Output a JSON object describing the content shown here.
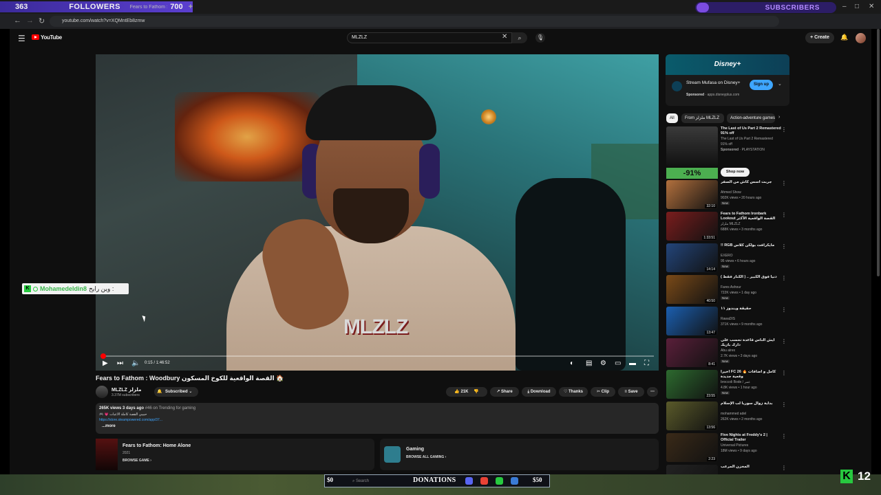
{
  "overlay": {
    "followers_count": "363",
    "followers_label": "FOLLOWERS",
    "followers_target": "700",
    "tab_text": "Fears to Fathom : Woodbury",
    "subscribers_label": "SUBSCRIBERS",
    "plus": "+"
  },
  "browser": {
    "url": "youtube.com/watch?v=XQMntEb8zmw"
  },
  "header": {
    "logo_text": "YouTube",
    "search_value": "MLZLZ",
    "create_label": "+ Create"
  },
  "player": {
    "time_current": "0:15",
    "time_total": "1:46:52",
    "progress": 0.002,
    "video_logo": "MLZLZ"
  },
  "chat": {
    "username": "Mohamedeldin8",
    "message": "وين رايح :"
  },
  "video": {
    "title": "Fears to Fathom : Woodbury القصة الواقعية للكوخ المسكون 🏠",
    "channel_name": "MLZLZ ملزلز",
    "channel_subs": "3.37M subscribers",
    "subscribed_label": "Subscribed",
    "likes": "21K",
    "share": "Share",
    "download": "Download",
    "thanks": "Thanks",
    "clip": "Clip",
    "save": "Save",
    "more_icon": "⋯"
  },
  "description": {
    "views": "265K views",
    "age": "3 days ago",
    "trending": "#46 on Trending for gaming",
    "line1": "🎮 💗 حبيبي القصة كاملة الاعبات",
    "link": "https://store.steampowered.com/app/37...",
    "more": "...more"
  },
  "game_card": {
    "title": "Fears to Fathom: Home Alone",
    "year": "2021",
    "browse": "BROWSE GAME"
  },
  "gaming_card": {
    "title": "Gaming",
    "browse": "BROWSE ALL GAMING"
  },
  "ad": {
    "brand": "Disney+",
    "title": "Stream Mufasa on Disney+",
    "sponsored": "Sponsored",
    "domain": "apps.disneyplus.com",
    "signup": "Sign up"
  },
  "chips": [
    "All",
    "From ملزلز MLZLZ",
    "Action-adventure games"
  ],
  "promo": {
    "title": "The Last of Us Part 2 Remastered 91% off",
    "line": "The Last of Us Part 2 Remastered",
    "line2": "91% off",
    "sponsored": "Sponsored",
    "advertiser": "PLAYSTATION",
    "discount": "-91%",
    "shop": "Shop now"
  },
  "recommendations": [
    {
      "title": "جربت أسس كاش من الصفر",
      "channel": "Ahmed Show",
      "meta": "902K views • 20 hours ago",
      "badge": "New",
      "duration": "32:10",
      "color": "#b2703d"
    },
    {
      "title": "Fears to Fathom Ironbark Lookout القصة الواقعية الأكثر رعبا",
      "channel": "ملزلز MLZLZ",
      "meta": "688K views • 3 months ago",
      "badge": "",
      "duration": "1:33:51",
      "color": "#7a1d1d"
    },
    {
      "title": "!! RGB مايكرافت بولكن كلاس",
      "channel": "EXERO",
      "meta": "95 views • 6 hours ago",
      "badge": "New",
      "duration": "14:14",
      "color": "#23457a"
    },
    {
      "title": "دنيا فوق الكبير .. ( الكنار فقط )",
      "channel": "Fares Ashour",
      "meta": "722K views • 1 day ago",
      "badge": "New",
      "duration": "40:50",
      "color": "#7a4a18"
    },
    {
      "title": "حقيقة ويندوز ١١",
      "channel": "RawaDIS",
      "meta": "371K views • 9 months ago",
      "badge": "",
      "duration": "13:47",
      "color": "#1b5fb0"
    },
    {
      "title": "أيش الناس قاعدة تحسب على دارك بازيك",
      "channel": "Abu alrex",
      "meta": "2.7K views • 3 days ago",
      "badge": "New",
      "duration": "8:41",
      "color": "#5a1f3a"
    },
    {
      "title": "أخيراً FC 26 🔥 كامل و اضافات وقعية جديدة",
      "channel": "broccoli Bode / عمر",
      "meta": "4.8K views • 1 hour ago",
      "badge": "New",
      "duration": "23:55",
      "color": "#2d6a2f"
    },
    {
      "title": "بداية زوال سوريا لب الإسلام",
      "channel": "mohammed adel",
      "meta": "262K views • 2 months ago",
      "badge": "",
      "duration": "13:56",
      "color": "#5a5a2a"
    },
    {
      "title": "Five Nights at Freddy's 2 | Official Trailer",
      "channel": "Universal Pictures",
      "meta": "18M views • 9 days ago",
      "badge": "",
      "duration": "2:23",
      "color": "#3a2a18"
    },
    {
      "title": "المخزن المرعب",
      "channel": "",
      "meta": "",
      "badge": "",
      "duration": "",
      "color": "#222"
    }
  ],
  "taskbar": {
    "donations_label": "DONATIONS",
    "amount_left": "$0",
    "amount_right": "$50",
    "search_placeholder": "Search",
    "viewers": "12",
    "kick_letter": "K"
  }
}
